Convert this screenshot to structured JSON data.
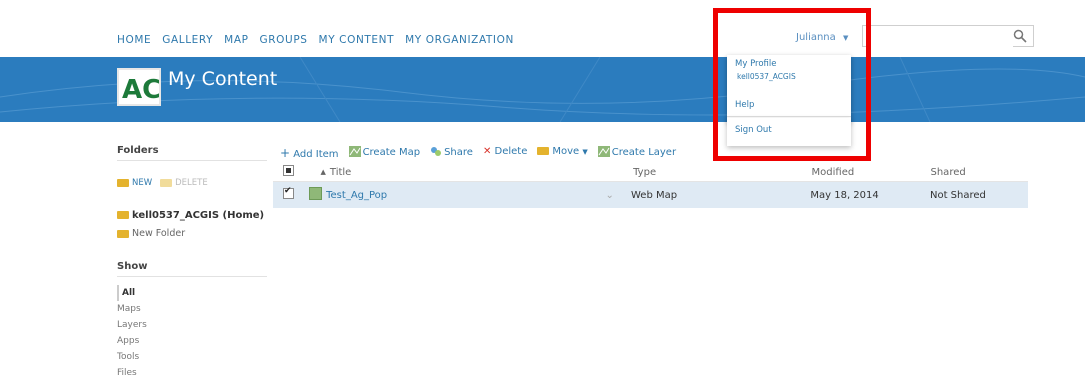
{
  "nav": {
    "items": [
      "HOME",
      "GALLERY",
      "MAP",
      "GROUPS",
      "MY CONTENT",
      "MY ORGANIZATION"
    ],
    "user": "Julianna",
    "search_value": ""
  },
  "banner": {
    "title": "My Content",
    "logo_text": "AC",
    "colors": {
      "banner": "#2b7cbe",
      "logo": "#1d7a3a",
      "highlight": "#ee0000"
    }
  },
  "user_menu": {
    "my_profile": "My Profile",
    "username": "kell0537_ACGIS",
    "help": "Help",
    "sign_out": "Sign Out"
  },
  "sidebar": {
    "folders_header": "Folders",
    "new_label": "NEW",
    "delete_label": "DELETE",
    "home_folder": "kell0537_ACGIS (Home)",
    "new_folder": "New Folder",
    "show_header": "Show",
    "filters": [
      "All",
      "Maps",
      "Layers",
      "Apps",
      "Tools",
      "Files"
    ]
  },
  "toolbar": {
    "add_item": "Add Item",
    "create_map": "Create Map",
    "share": "Share",
    "delete": "Delete",
    "move": "Move",
    "create_layer": "Create Layer"
  },
  "table": {
    "headers": {
      "title": "Title",
      "type": "Type",
      "modified": "Modified",
      "shared": "Shared"
    },
    "rows": [
      {
        "title": "Test_Ag_Pop",
        "type": "Web Map",
        "modified": "May 18, 2014",
        "shared": "Not Shared"
      }
    ]
  }
}
